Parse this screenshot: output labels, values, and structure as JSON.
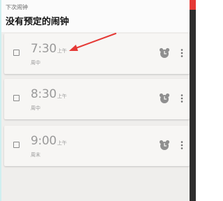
{
  "header": {
    "subtitle": "下次闹钟",
    "title": "没有预定的闹钟"
  },
  "alarms": [
    {
      "time": "7:30",
      "ampm": "上午",
      "repeat": "周中",
      "enabled": false
    },
    {
      "time": "8:30",
      "ampm": "上午",
      "repeat": "周中",
      "enabled": false
    },
    {
      "time": "9:00",
      "ampm": "上午",
      "repeat": "周末",
      "enabled": false
    }
  ],
  "icons": {
    "alarm": "alarm-clock-icon",
    "more": "more-vertical-icon"
  },
  "colors": {
    "annotation_arrow": "#e53935",
    "card_background": "#f7f6f4",
    "app_background": "#efeeec",
    "muted_text": "#9a9a9a"
  }
}
